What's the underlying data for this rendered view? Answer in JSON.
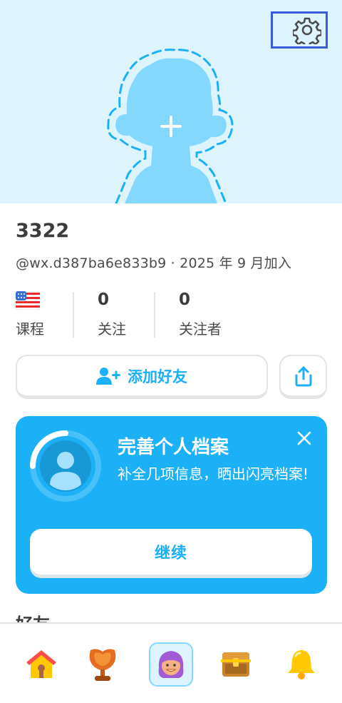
{
  "profile": {
    "username": "3322",
    "handle": "@wx.d387ba6e833b9 · 2025 年 9 月加入"
  },
  "stats": [
    {
      "value": "",
      "label": "课程",
      "icon": "us-flag-icon"
    },
    {
      "value": "0",
      "label": "关注"
    },
    {
      "value": "0",
      "label": "关注者"
    }
  ],
  "actions": {
    "add_friend": "添加好友",
    "share_icon": "share-icon",
    "settings_icon": "gear-icon"
  },
  "card": {
    "title": "完善个人档案",
    "description": "补全几项信息，晒出闪亮档案!",
    "button": "继续",
    "progress": 0.25
  },
  "section_peek": "好友",
  "nav": [
    "home-icon",
    "leagues-trophy-icon",
    "profile-avatar-icon",
    "treasure-chest-icon",
    "bell-icon"
  ],
  "colors": {
    "accent": "#1cb0f6",
    "hero_bg": "#ddf4ff",
    "highlight": "#3a5ad9"
  }
}
